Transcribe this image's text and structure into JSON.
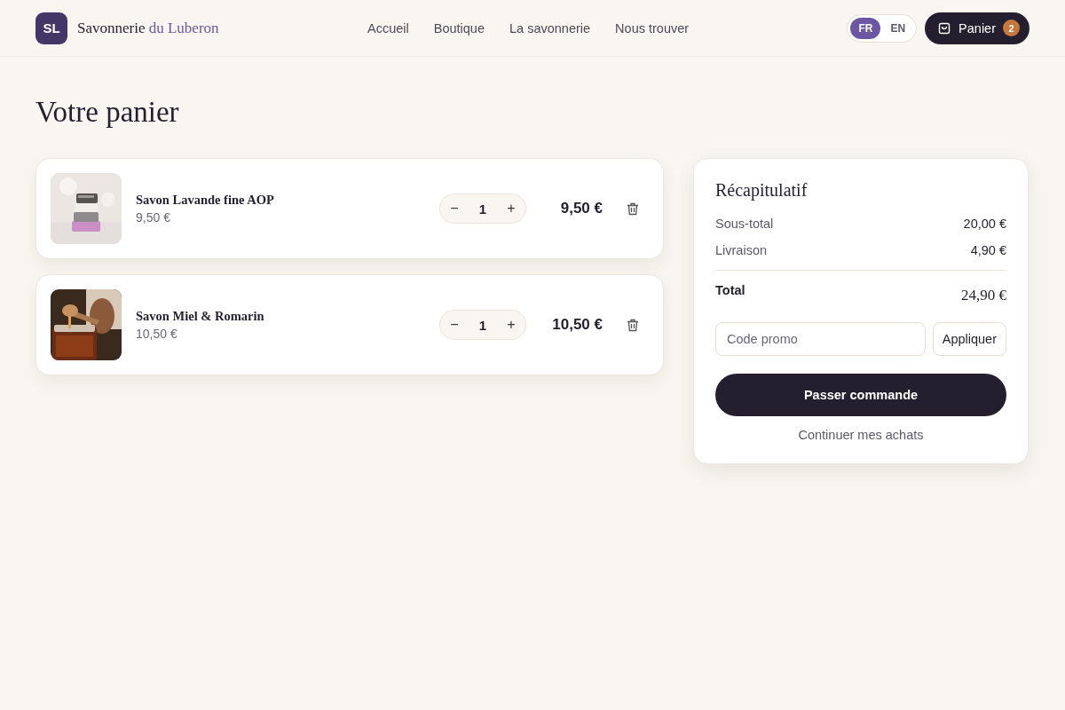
{
  "header": {
    "logo": "SL",
    "brand": {
      "name": "Savonnerie",
      "accent": "du Luberon"
    },
    "nav": [
      {
        "label": "Accueil"
      },
      {
        "label": "Boutique"
      },
      {
        "label": "La savonnerie"
      },
      {
        "label": "Nous trouver"
      }
    ],
    "languages": [
      {
        "label": "FR",
        "selected": true
      },
      {
        "label": "EN",
        "selected": false
      }
    ],
    "cart": {
      "label": "Panier",
      "count": "2"
    }
  },
  "title": "Votre panier",
  "items": [
    {
      "name": "Savon Lavande fine AOP",
      "unit_price": "9,50 €",
      "minus": "−",
      "quantity": "1",
      "plus": "+",
      "total": "9,50 €"
    },
    {
      "name": "Savon Miel & Romarin",
      "unit_price": "10,50 €",
      "minus": "−",
      "quantity": "1",
      "plus": "+",
      "total": "10,50 €"
    }
  ],
  "summary": {
    "title": "Récapitulatif",
    "lines": [
      {
        "label": "Sous-total",
        "value": "20,00 €"
      },
      {
        "label": "Livraison",
        "value": "4,90 €"
      }
    ],
    "total": {
      "label": "Total",
      "value": "24,90 €"
    },
    "promo": {
      "placeholder": "Code promo",
      "button": "Appliquer"
    },
    "checkout": "Passer commande",
    "continue": "Continuer mes achats"
  }
}
